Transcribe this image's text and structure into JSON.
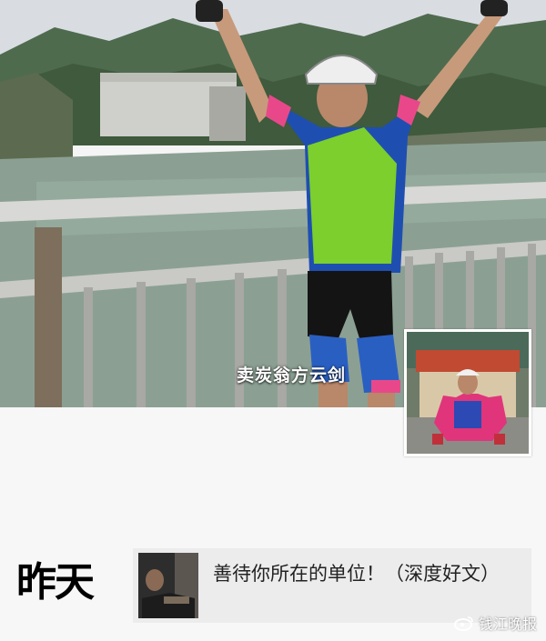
{
  "cover": {
    "caption": "卖炭翁方云剑",
    "image_icon": "cyclist-on-bridge-photo"
  },
  "avatar": {
    "icon": "cyclist-avatar-photo"
  },
  "timeline": {
    "date_label": "昨天",
    "post": {
      "thumb_icon": "article-thumbnail",
      "text": "善待你所在的单位！（深度好文）"
    }
  },
  "watermark": {
    "text": "钱江晚报",
    "icon": "weibo-icon"
  }
}
